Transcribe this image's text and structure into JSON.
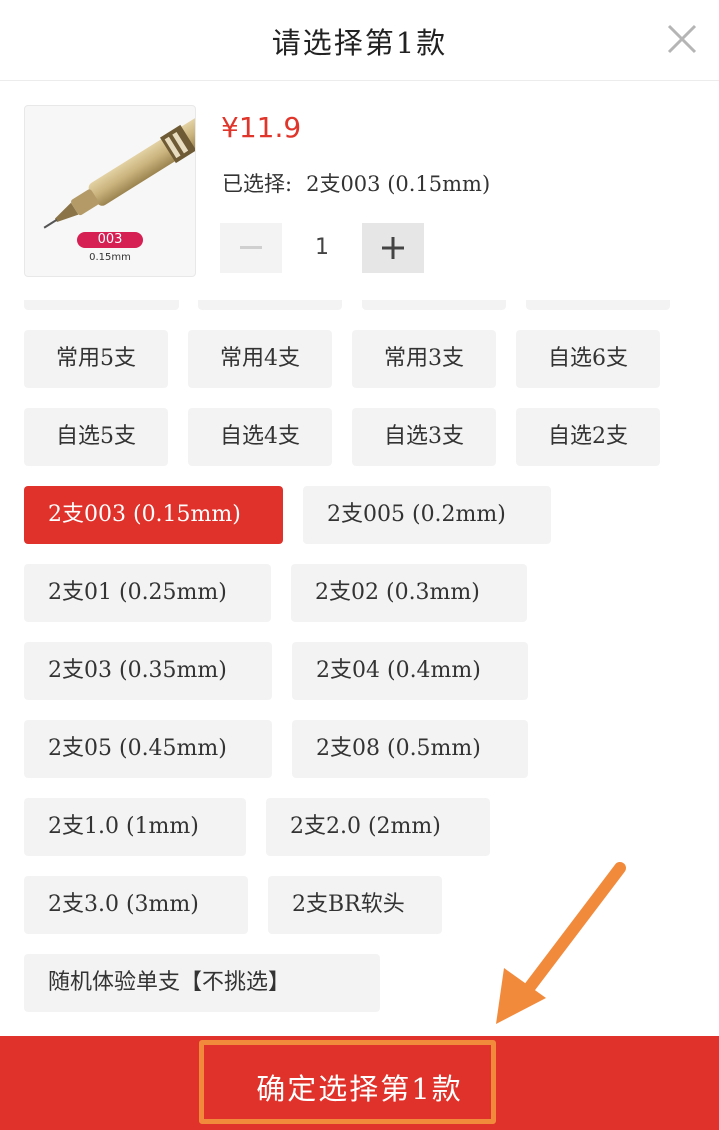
{
  "header": {
    "title": "请选择第1款",
    "close_icon": "close-icon"
  },
  "product": {
    "image_badge": "003",
    "image_size": "0.15mm",
    "price": "¥11.9",
    "selected_label": "已选择:",
    "selected_value": "2支003 (0.15mm)",
    "quantity": "1",
    "minus_icon": "minus-icon",
    "plus_icon": "plus-icon"
  },
  "options": [
    {
      "label": "常用5支",
      "selected": false
    },
    {
      "label": "常用4支",
      "selected": false
    },
    {
      "label": "常用3支",
      "selected": false
    },
    {
      "label": "自选6支",
      "selected": false
    },
    {
      "label": "自选5支",
      "selected": false
    },
    {
      "label": "自选4支",
      "selected": false
    },
    {
      "label": "自选3支",
      "selected": false
    },
    {
      "label": "自选2支",
      "selected": false
    },
    {
      "label": "2支003 (0.15mm)",
      "selected": true
    },
    {
      "label": "2支005 (0.2mm)",
      "selected": false
    },
    {
      "label": "2支01 (0.25mm)",
      "selected": false
    },
    {
      "label": "2支02 (0.3mm)",
      "selected": false
    },
    {
      "label": "2支03 (0.35mm)",
      "selected": false
    },
    {
      "label": "2支04 (0.4mm)",
      "selected": false
    },
    {
      "label": "2支05 (0.45mm)",
      "selected": false
    },
    {
      "label": "2支08 (0.5mm)",
      "selected": false
    },
    {
      "label": "2支1.0 (1mm)",
      "selected": false
    },
    {
      "label": "2支2.0 (2mm)",
      "selected": false
    },
    {
      "label": "2支3.0 (3mm)",
      "selected": false
    },
    {
      "label": "2支BR软头",
      "selected": false
    },
    {
      "label": "随机体验单支【不挑选】",
      "selected": false
    }
  ],
  "confirm": {
    "label": "确定选择第1款"
  },
  "colors": {
    "accent": "#e0322a",
    "price": "#e0352b",
    "annotation": "#f28a3c"
  }
}
